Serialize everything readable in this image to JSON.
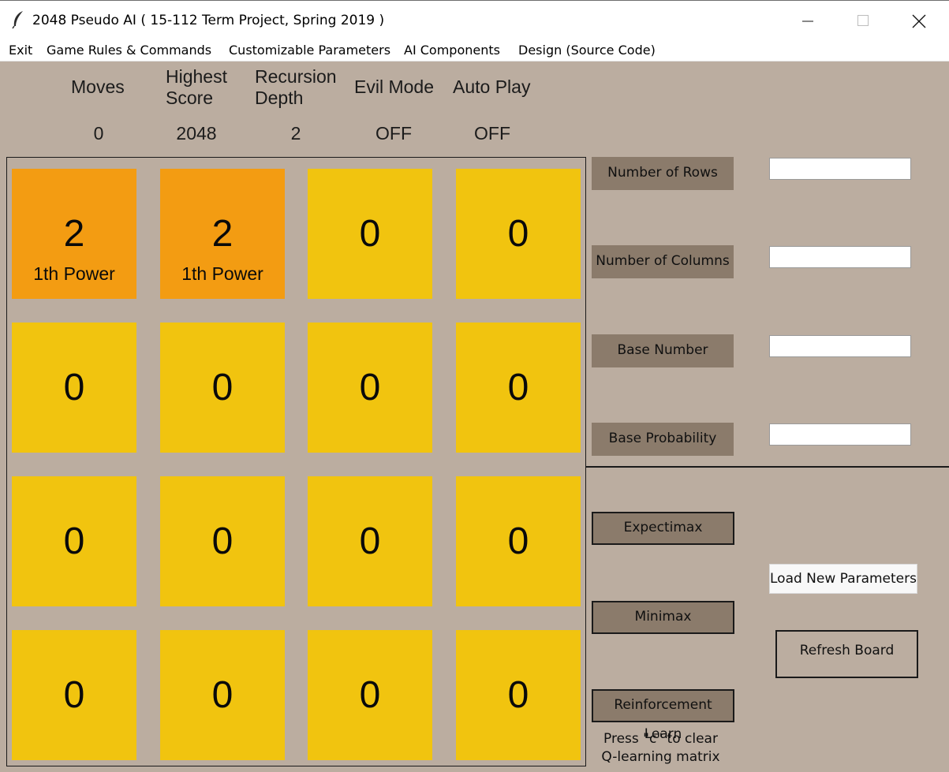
{
  "window": {
    "title": "2048 Pseudo AI ( 15-112 Term Project, Spring 2019 )",
    "icon": "feather-icon"
  },
  "menu": [
    "Exit",
    "Game Rules & Commands",
    "Customizable Parameters",
    "AI Components",
    "Design (Source Code)"
  ],
  "stats": {
    "moves": {
      "label": "Moves",
      "value": "0"
    },
    "highest_score": {
      "label_line1": "Highest",
      "label_line2": "Score",
      "value": "2048"
    },
    "recursion_depth": {
      "label_line1": "Recursion",
      "label_line2": "Depth",
      "value": "2"
    },
    "evil_mode": {
      "label": "Evil Mode",
      "value": "OFF"
    },
    "auto_play": {
      "label": "Auto Play",
      "value": "OFF"
    }
  },
  "board": {
    "rows": [
      [
        {
          "value": "2",
          "sub": "1th Power"
        },
        {
          "value": "2",
          "sub": "1th Power"
        },
        {
          "value": "0",
          "sub": ""
        },
        {
          "value": "0",
          "sub": ""
        }
      ],
      [
        {
          "value": "0",
          "sub": ""
        },
        {
          "value": "0",
          "sub": ""
        },
        {
          "value": "0",
          "sub": ""
        },
        {
          "value": "0",
          "sub": ""
        }
      ],
      [
        {
          "value": "0",
          "sub": ""
        },
        {
          "value": "0",
          "sub": ""
        },
        {
          "value": "0",
          "sub": ""
        },
        {
          "value": "0",
          "sub": ""
        }
      ],
      [
        {
          "value": "0",
          "sub": ""
        },
        {
          "value": "0",
          "sub": ""
        },
        {
          "value": "0",
          "sub": ""
        },
        {
          "value": "0",
          "sub": ""
        }
      ]
    ]
  },
  "params": {
    "rows_label": "Number of Rows",
    "columns_label": "Number of Columns",
    "base_number_label": "Base Number",
    "base_probability_label": "Base Probability",
    "rows_value": "",
    "columns_value": "",
    "base_number_value": "",
    "base_probability_value": ""
  },
  "ai": {
    "expectimax": "Expectimax",
    "minimax": "Minimax",
    "reinforcement": "Reinforcement Learn",
    "hint_line1": "Press \"c\" to clear",
    "hint_line2": "Q-learning matrix"
  },
  "actions": {
    "load": "Load New Parameters",
    "refresh": "Refresh Board"
  },
  "colors": {
    "background": "#bbada0",
    "tile_yellow": "#f1c40f",
    "tile_orange": "#f39c12",
    "button_brown": "#8b7b6b"
  }
}
